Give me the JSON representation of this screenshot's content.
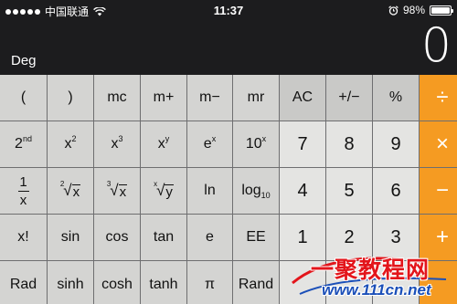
{
  "status_bar": {
    "carrier": "中国联通",
    "time": "11:37",
    "battery": "98%",
    "battery_level": 0.98
  },
  "display": {
    "mode": "Deg",
    "value": "0"
  },
  "keys": {
    "row1": [
      "(",
      ")",
      "mc",
      "m+",
      "m−",
      "mr",
      "AC",
      "+/−",
      "%",
      "÷"
    ],
    "row2": {
      "second_base": "2",
      "second_sup": "nd",
      "x2_base": "x",
      "x2_sup": "2",
      "x3_base": "x",
      "x3_sup": "3",
      "xy_base": "x",
      "xy_sup": "y",
      "ex_base": "e",
      "ex_sup": "x",
      "tenx_base": "10",
      "tenx_sup": "x",
      "d7": "7",
      "d8": "8",
      "d9": "9",
      "multiply": "×"
    },
    "row3": {
      "inv_num": "1",
      "inv_den": "x",
      "sqrt2_idx": "2",
      "sqrt2_arg": "x",
      "sqrt3_idx": "3",
      "sqrt3_arg": "x",
      "sqrty_idx": "x",
      "sqrty_arg": "y",
      "ln": "ln",
      "log_base": "log",
      "log_sub": "10",
      "d4": "4",
      "d5": "5",
      "d6": "6",
      "minus": "−"
    },
    "row4": [
      "x!",
      "sin",
      "cos",
      "tan",
      "e",
      "EE",
      "1",
      "2",
      "3",
      "+"
    ],
    "row5": [
      "Rad",
      "sinh",
      "cosh",
      "tanh",
      "π",
      "Rand"
    ]
  },
  "watermark": {
    "title": "一聚教程网",
    "url": "www.111cn.net"
  }
}
